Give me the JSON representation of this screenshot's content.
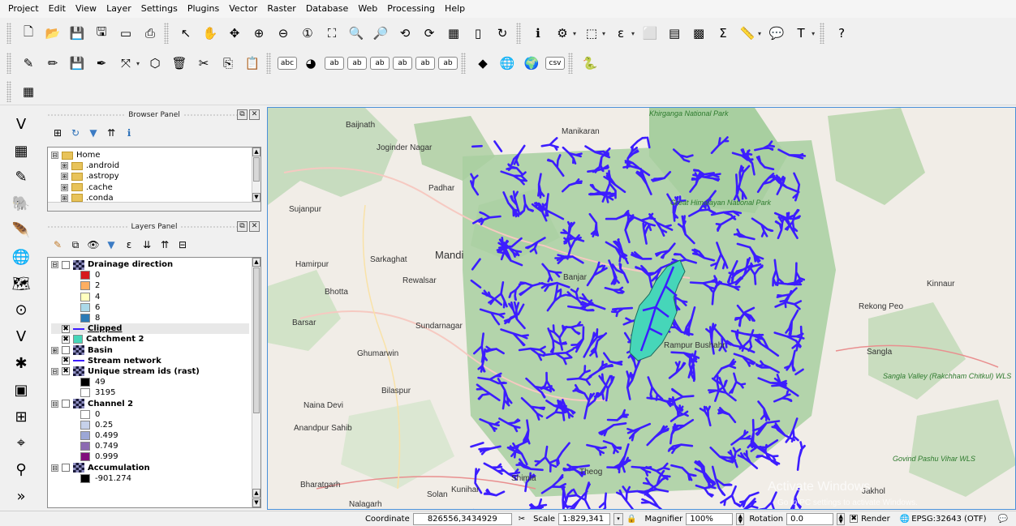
{
  "menubar": [
    "Project",
    "Edit",
    "View",
    "Layer",
    "Settings",
    "Plugins",
    "Vector",
    "Raster",
    "Database",
    "Web",
    "Processing",
    "Help"
  ],
  "toolbar_main": [
    {
      "name": "new-project-icon",
      "glyph": "🗋"
    },
    {
      "name": "open-project-icon",
      "glyph": "📂"
    },
    {
      "name": "save-project-icon",
      "glyph": "💾"
    },
    {
      "name": "save-as-icon",
      "glyph": "🖫"
    },
    {
      "name": "print-composer-icon",
      "glyph": "▭"
    },
    {
      "name": "composer-manager-icon",
      "glyph": "⎙"
    },
    {
      "name": "select-pan-icon",
      "glyph": "↖"
    },
    {
      "name": "pan-map-icon",
      "glyph": "✋"
    },
    {
      "name": "pan-to-selection-icon",
      "glyph": "✥"
    },
    {
      "name": "zoom-in-icon",
      "glyph": "⊕"
    },
    {
      "name": "zoom-out-icon",
      "glyph": "⊖"
    },
    {
      "name": "zoom-native-icon",
      "glyph": "①"
    },
    {
      "name": "zoom-full-icon",
      "glyph": "⛶"
    },
    {
      "name": "zoom-selection-icon",
      "glyph": "🔍"
    },
    {
      "name": "zoom-layer-icon",
      "glyph": "🔎"
    },
    {
      "name": "zoom-last-icon",
      "glyph": "⟲"
    },
    {
      "name": "zoom-next-icon",
      "glyph": "⟳"
    },
    {
      "name": "new-map-view-icon",
      "glyph": "▦"
    },
    {
      "name": "bookmark-icon",
      "glyph": "▯"
    },
    {
      "name": "refresh-icon",
      "glyph": "↻"
    },
    {
      "name": "identify-icon",
      "glyph": "ℹ"
    },
    {
      "name": "actions-icon",
      "glyph": "⚙"
    },
    {
      "name": "select-features-icon",
      "glyph": "⬚"
    },
    {
      "name": "select-by-value-icon",
      "glyph": "ε"
    },
    {
      "name": "deselect-icon",
      "glyph": "⬜"
    },
    {
      "name": "attribute-table-icon",
      "glyph": "▤"
    },
    {
      "name": "field-calculator-icon",
      "glyph": "▩"
    },
    {
      "name": "statistics-icon",
      "glyph": "Σ"
    },
    {
      "name": "measure-icon",
      "glyph": "📏"
    },
    {
      "name": "map-tips-icon",
      "glyph": "💬"
    },
    {
      "name": "text-annotation-icon",
      "glyph": "T"
    },
    {
      "name": "help-icon",
      "glyph": "?"
    }
  ],
  "toolbar_edit": [
    {
      "name": "current-edits-icon",
      "glyph": "✎"
    },
    {
      "name": "toggle-editing-icon",
      "glyph": "✏"
    },
    {
      "name": "save-edits-icon",
      "glyph": "💾"
    },
    {
      "name": "add-feature-icon",
      "glyph": "✒"
    },
    {
      "name": "move-feature-icon",
      "glyph": "⤧"
    },
    {
      "name": "node-tool-icon",
      "glyph": "⬡"
    },
    {
      "name": "delete-selected-icon",
      "glyph": "🗑"
    },
    {
      "name": "cut-features-icon",
      "glyph": "✂"
    },
    {
      "name": "copy-features-icon",
      "glyph": "⎘"
    },
    {
      "name": "paste-features-icon",
      "glyph": "📋"
    },
    {
      "name": "label-abc-icon",
      "glyph": "abc"
    },
    {
      "name": "diagram-icon",
      "glyph": "◕"
    },
    {
      "name": "pin-labels-icon",
      "glyph": "ab"
    },
    {
      "name": "show-labels-icon",
      "glyph": "ab"
    },
    {
      "name": "move-label-icon",
      "glyph": "ab"
    },
    {
      "name": "rotate-label-icon",
      "glyph": "ab"
    },
    {
      "name": "change-label-icon",
      "glyph": "ab"
    },
    {
      "name": "label-props-icon",
      "glyph": "ab"
    },
    {
      "name": "layer-style-icon",
      "glyph": "◆"
    },
    {
      "name": "wms-icon",
      "glyph": "🌐"
    },
    {
      "name": "wfs-icon",
      "glyph": "🌍"
    },
    {
      "name": "csv-icon",
      "glyph": "csv"
    },
    {
      "name": "python-icon",
      "glyph": "🐍"
    }
  ],
  "toolbar_plugins": [
    {
      "name": "raster-plugin-icon",
      "glyph": "▦"
    }
  ],
  "side_tools": [
    {
      "name": "add-vector-layer-icon",
      "glyph": "V"
    },
    {
      "name": "add-raster-layer-icon",
      "glyph": "▦"
    },
    {
      "name": "add-delimited-text-icon",
      "glyph": "✎"
    },
    {
      "name": "add-postgis-layer-icon",
      "glyph": "🐘"
    },
    {
      "name": "add-spatialite-layer-icon",
      "glyph": "🪶"
    },
    {
      "name": "add-wms-layer-icon",
      "glyph": "🌐"
    },
    {
      "name": "add-wcs-layer-icon",
      "glyph": "🗺"
    },
    {
      "name": "add-oracle-layer-icon",
      "glyph": "⊙"
    },
    {
      "name": "add-mssql-layer-icon",
      "glyph": "V"
    },
    {
      "name": "new-shapefile-icon",
      "glyph": "✱"
    },
    {
      "name": "new-spatialite-icon",
      "glyph": "▣"
    },
    {
      "name": "new-temp-layer-icon",
      "glyph": "⊞"
    },
    {
      "name": "add-gps-icon",
      "glyph": "⌖"
    },
    {
      "name": "georeference-icon",
      "glyph": "⚲"
    },
    {
      "name": "more-tools-icon",
      "glyph": "»"
    }
  ],
  "browser_panel": {
    "title": "Browser Panel",
    "tree": [
      {
        "label": "Home",
        "level": 0,
        "expander": "⊟"
      },
      {
        "label": ".android",
        "level": 1,
        "expander": "⊞"
      },
      {
        "label": ".astropy",
        "level": 1,
        "expander": "⊞"
      },
      {
        "label": ".cache",
        "level": 1,
        "expander": "⊞"
      },
      {
        "label": ".conda",
        "level": 1,
        "expander": "⊞"
      }
    ]
  },
  "layers_panel": {
    "title": "Layers Panel",
    "items": [
      {
        "label": "Drainage direction",
        "type": "raster",
        "checked": false,
        "expander": "⊟",
        "bold": true
      },
      {
        "label": "0",
        "type": "swatch",
        "color": "#d7191c"
      },
      {
        "label": "2",
        "type": "swatch",
        "color": "#fdae61"
      },
      {
        "label": "4",
        "type": "swatch",
        "color": "#ffffbf"
      },
      {
        "label": "6",
        "type": "swatch",
        "color": "#abd9e9"
      },
      {
        "label": "8",
        "type": "swatch",
        "color": "#2c7bb6"
      },
      {
        "label": "Clipped",
        "type": "line",
        "checked": true,
        "bold": true,
        "underline": true
      },
      {
        "label": "Catchment 2",
        "type": "fill",
        "checked": true,
        "bold": true,
        "color": "#46d6b9"
      },
      {
        "label": "Basin",
        "type": "raster",
        "checked": false,
        "expander": "⊞",
        "bold": true
      },
      {
        "label": "Stream network",
        "type": "line",
        "checked": true,
        "bold": true
      },
      {
        "label": "Unique stream ids (rast)",
        "type": "raster",
        "checked": true,
        "expander": "⊟",
        "bold": true
      },
      {
        "label": "49",
        "type": "swatch",
        "color": "#000000"
      },
      {
        "label": "3195",
        "type": "swatch",
        "color": "#ffffff"
      },
      {
        "label": "Channel 2",
        "type": "raster",
        "checked": false,
        "expander": "⊟",
        "bold": true
      },
      {
        "label": "0",
        "type": "swatch",
        "color": "#ffffff"
      },
      {
        "label": "0.25",
        "type": "swatch",
        "color": "#c6d1ea"
      },
      {
        "label": "0.499",
        "type": "swatch",
        "color": "#9ca7d6"
      },
      {
        "label": "0.749",
        "type": "swatch",
        "color": "#8c6bb1"
      },
      {
        "label": "0.999",
        "type": "swatch",
        "color": "#810f7c"
      },
      {
        "label": "Accumulation",
        "type": "raster",
        "checked": false,
        "expander": "⊟",
        "bold": true
      },
      {
        "label": "-901.274",
        "type": "swatch",
        "color": "#000000"
      }
    ]
  },
  "map": {
    "labels": [
      {
        "text": "Baijnath"
      },
      {
        "text": "Joginder Nagar"
      },
      {
        "text": "Manikaran"
      },
      {
        "text": "Padhar"
      },
      {
        "text": "Sujanpur"
      },
      {
        "text": "Mandi"
      },
      {
        "text": "Sarkaghat"
      },
      {
        "text": "Hamirpur"
      },
      {
        "text": "Rewalsar"
      },
      {
        "text": "Bhotta"
      },
      {
        "text": "Barsar"
      },
      {
        "text": "Sundarnagar"
      },
      {
        "text": "Ghumarwin"
      },
      {
        "text": "Bilaspur"
      },
      {
        "text": "Naina Devi"
      },
      {
        "text": "Anandpur Sahib"
      },
      {
        "text": "Bharatgarh"
      },
      {
        "text": "Nalagarh"
      },
      {
        "text": "Solan"
      },
      {
        "text": "Kunihar"
      },
      {
        "text": "Shimla"
      },
      {
        "text": "Theog"
      },
      {
        "text": "Banjar"
      },
      {
        "text": "Rampur Bushahr"
      },
      {
        "text": "Kinnaur"
      },
      {
        "text": "Rekong Peo"
      },
      {
        "text": "Sangla"
      },
      {
        "text": "Jakhol"
      },
      {
        "text": "Khirganga National Park"
      },
      {
        "text": "Great Himalayan National Park"
      },
      {
        "text": "Sangla Valley (Rakchham Chitkul) WLS"
      },
      {
        "text": "Govind Pashu Vihar WLS"
      }
    ],
    "watermark": "Activate Windows",
    "watermark_sub": "Go to PC settings to activate Windows.",
    "colors": {
      "streams": "#3c1dff",
      "catchment": "#46d6b9",
      "forest": "#a8cfa0",
      "land": "#f1ede7"
    }
  },
  "statusbar": {
    "coordinate_label": "Coordinate",
    "coordinate_value": "826556,3434929",
    "scale_label": "Scale",
    "scale_value": "1:829,341",
    "magnifier_label": "Magnifier",
    "magnifier_value": "100%",
    "rotation_label": "Rotation",
    "rotation_value": "0.0",
    "render_label": "Render",
    "crs_label": "EPSG:32643 (OTF)"
  }
}
